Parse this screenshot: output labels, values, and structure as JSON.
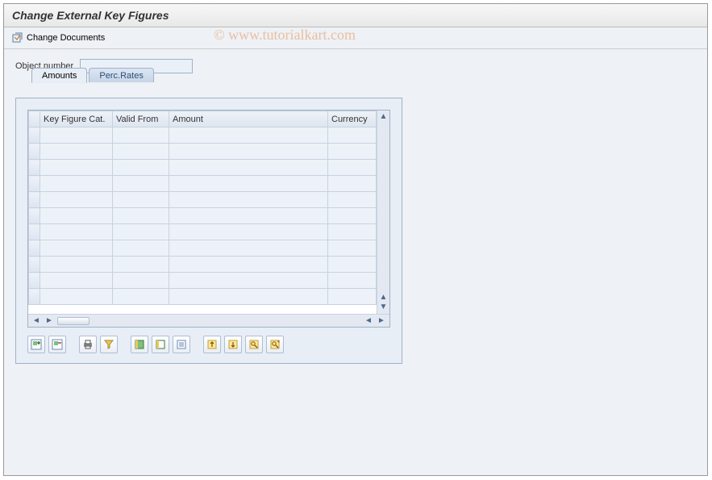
{
  "title": "Change External Key Figures",
  "toolbar": {
    "change_documents_label": "Change Documents"
  },
  "watermark": "© www.tutorialkart.com",
  "fields": {
    "object_number": {
      "label": "Object number",
      "value": ""
    }
  },
  "tabs": {
    "amounts": "Amounts",
    "perc_rates": "Perc.Rates",
    "active": "amounts"
  },
  "grid": {
    "columns": [
      "Key Figure Cat.",
      "Valid From",
      "Amount",
      "Currency"
    ],
    "rows": [
      [
        "",
        "",
        "",
        ""
      ],
      [
        "",
        "",
        "",
        ""
      ],
      [
        "",
        "",
        "",
        ""
      ],
      [
        "",
        "",
        "",
        ""
      ],
      [
        "",
        "",
        "",
        ""
      ],
      [
        "",
        "",
        "",
        ""
      ],
      [
        "",
        "",
        "",
        ""
      ],
      [
        "",
        "",
        "",
        ""
      ],
      [
        "",
        "",
        "",
        ""
      ],
      [
        "",
        "",
        "",
        ""
      ],
      [
        "",
        "",
        "",
        ""
      ]
    ]
  },
  "icons": {
    "insert_row": "insert-row",
    "delete_row": "delete-row",
    "print": "print",
    "filter": "filter",
    "select_all": "select-all",
    "deselect_all": "deselect-all",
    "details": "details",
    "sort_asc": "sort-asc",
    "sort_desc": "sort-desc",
    "find": "find",
    "find_next": "find-next"
  }
}
